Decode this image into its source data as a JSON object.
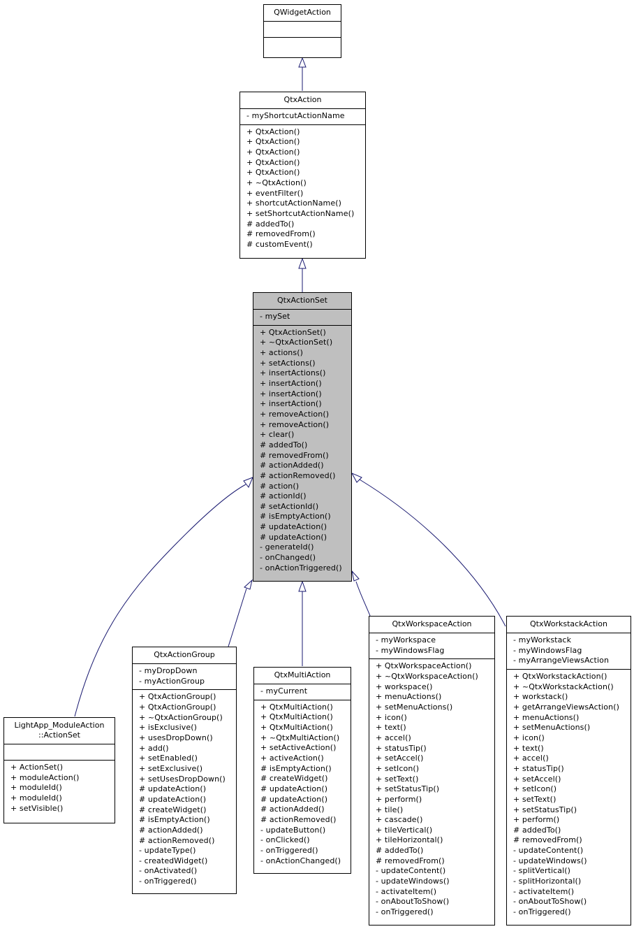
{
  "diagram": {
    "type": "class-inheritance",
    "focus_class": "QtxActionSet",
    "colors": {
      "edge": "#191970",
      "focus_fill": "#bfbfbf",
      "box_fill": "#ffffff",
      "border": "#000000"
    },
    "classes": {
      "qwidgetaction": {
        "name": "QWidgetAction",
        "attributes": [],
        "operations": []
      },
      "qtxaction": {
        "name": "QtxAction",
        "attributes": [
          "- myShortcutActionName"
        ],
        "operations": [
          "+ QtxAction()",
          "+ QtxAction()",
          "+ QtxAction()",
          "+ QtxAction()",
          "+ QtxAction()",
          "+ ~QtxAction()",
          "+ eventFilter()",
          "+ shortcutActionName()",
          "+ setShortcutActionName()",
          "# addedTo()",
          "# removedFrom()",
          "# customEvent()"
        ]
      },
      "qtxactionset": {
        "name": "QtxActionSet",
        "attributes": [
          "- mySet"
        ],
        "operations": [
          "+ QtxActionSet()",
          "+ ~QtxActionSet()",
          "+ actions()",
          "+ setActions()",
          "+ insertActions()",
          "+ insertAction()",
          "+ insertAction()",
          "+ insertAction()",
          "+ removeAction()",
          "+ removeAction()",
          "+ clear()",
          "# addedTo()",
          "# removedFrom()",
          "# actionAdded()",
          "# actionRemoved()",
          "# action()",
          "# actionId()",
          "# setActionId()",
          "# isEmptyAction()",
          "# updateAction()",
          "# updateAction()",
          "- generateId()",
          "- onChanged()",
          "- onActionTriggered()"
        ]
      },
      "lightapp_actionset": {
        "name": "LightApp_ModuleAction\n::ActionSet",
        "attributes": [],
        "operations": [
          "+ ActionSet()",
          "+ moduleAction()",
          "+ moduleId()",
          "+ moduleId()",
          "+ setVisible()"
        ]
      },
      "qtxactiongroup": {
        "name": "QtxActionGroup",
        "attributes": [
          "- myDropDown",
          "- myActionGroup"
        ],
        "operations": [
          "+ QtxActionGroup()",
          "+ QtxActionGroup()",
          "+ ~QtxActionGroup()",
          "+ isExclusive()",
          "+ usesDropDown()",
          "+ add()",
          "+ setEnabled()",
          "+ setExclusive()",
          "+ setUsesDropDown()",
          "# updateAction()",
          "# updateAction()",
          "# createWidget()",
          "# isEmptyAction()",
          "# actionAdded()",
          "# actionRemoved()",
          "- updateType()",
          "- createdWidget()",
          "- onActivated()",
          "- onTriggered()"
        ]
      },
      "qtxmultiaction": {
        "name": "QtxMultiAction",
        "attributes": [
          "- myCurrent"
        ],
        "operations": [
          "+ QtxMultiAction()",
          "+ QtxMultiAction()",
          "+ QtxMultiAction()",
          "+ ~QtxMultiAction()",
          "+ setActiveAction()",
          "+ activeAction()",
          "# isEmptyAction()",
          "# createWidget()",
          "# updateAction()",
          "# updateAction()",
          "# actionAdded()",
          "# actionRemoved()",
          "- updateButton()",
          "- onClicked()",
          "- onTriggered()",
          "- onActionChanged()"
        ]
      },
      "qtxworkspaceaction": {
        "name": "QtxWorkspaceAction",
        "attributes": [
          "- myWorkspace",
          "- myWindowsFlag"
        ],
        "operations": [
          "+ QtxWorkspaceAction()",
          "+ ~QtxWorkspaceAction()",
          "+ workspace()",
          "+ menuActions()",
          "+ setMenuActions()",
          "+ icon()",
          "+ text()",
          "+ accel()",
          "+ statusTip()",
          "+ setAccel()",
          "+ setIcon()",
          "+ setText()",
          "+ setStatusTip()",
          "+ perform()",
          "+ tile()",
          "+ cascade()",
          "+ tileVertical()",
          "+ tileHorizontal()",
          "# addedTo()",
          "# removedFrom()",
          "- updateContent()",
          "- updateWindows()",
          "- activateItem()",
          "- onAboutToShow()",
          "- onTriggered()"
        ]
      },
      "qtxworkstackaction": {
        "name": "QtxWorkstackAction",
        "attributes": [
          "- myWorkstack",
          "- myWindowsFlag",
          "- myArrangeViewsAction"
        ],
        "operations": [
          "+ QtxWorkstackAction()",
          "+ ~QtxWorkstackAction()",
          "+ workstack()",
          "+ getArrangeViewsAction()",
          "+ menuActions()",
          "+ setMenuActions()",
          "+ icon()",
          "+ text()",
          "+ accel()",
          "+ statusTip()",
          "+ setAccel()",
          "+ setIcon()",
          "+ setText()",
          "+ setStatusTip()",
          "+ perform()",
          "# addedTo()",
          "# removedFrom()",
          "- updateContent()",
          "- updateWindows()",
          "- splitVertical()",
          "- splitHorizontal()",
          "- activateItem()",
          "- onAboutToShow()",
          "- onTriggered()"
        ]
      }
    },
    "inheritance": [
      {
        "child": "qtxaction",
        "parent": "qwidgetaction"
      },
      {
        "child": "qtxactionset",
        "parent": "qtxaction"
      },
      {
        "child": "lightapp_actionset",
        "parent": "qtxactionset"
      },
      {
        "child": "qtxactiongroup",
        "parent": "qtxactionset"
      },
      {
        "child": "qtxmultiaction",
        "parent": "qtxactionset"
      },
      {
        "child": "qtxworkspaceaction",
        "parent": "qtxactionset"
      },
      {
        "child": "qtxworkstackaction",
        "parent": "qtxactionset"
      }
    ]
  }
}
